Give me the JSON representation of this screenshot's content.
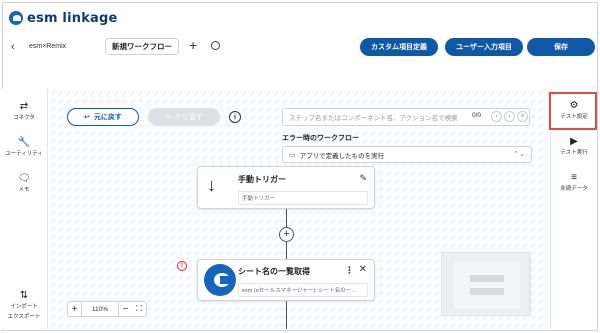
{
  "app": {
    "logo_text": "esm linkage"
  },
  "subbar": {
    "back_icon": "chevron-left-icon",
    "breadcrumb": "esm×Remix",
    "flow_title": "新規ワークフロー",
    "add_symbol": "+",
    "custom_fields_button": "カスタム項目定義",
    "user_input_button": "ユーザー入力項目",
    "save_button": "保存"
  },
  "left_panel": {
    "items": [
      {
        "label": "コネクタ",
        "icon": "swap-arrows-icon",
        "glyph": "⇄"
      },
      {
        "label": "ユーティリティ",
        "icon": "wrench-icon",
        "glyph": "🔧"
      },
      {
        "label": "メモ",
        "icon": "memo-icon",
        "glyph": "🗨"
      },
      {
        "label": "インポート",
        "label2": "エクスポート",
        "icon": "import-export-icon",
        "glyph": "⇅"
      }
    ]
  },
  "right_panel": {
    "items": [
      {
        "label": "テスト設定",
        "icon": "gear-icon",
        "glyph": "⚙"
      },
      {
        "label": "テスト実行",
        "icon": "play-circle-icon",
        "glyph": "▶"
      },
      {
        "label": "永続データ",
        "icon": "database-icon",
        "glyph": "≡"
      }
    ]
  },
  "toolbar": {
    "undo_label": "元に戻す",
    "redo_label": "やり直す",
    "info_glyph": "i",
    "search_placeholder": "ステップ名またはコンポーネント名、アクション名で検索",
    "search_count": "0/0"
  },
  "error_workflow": {
    "label": "エラー時のワークフロー",
    "selected": "アプリで定義したものを実行"
  },
  "nodes": {
    "trigger": {
      "title": "手動トリガー",
      "subtitle": "手動トリガー"
    },
    "step": {
      "title": "シート名の一覧取得",
      "subtitle": "esm (eセールスマネージャー): シート名の一..."
    },
    "add_symbol": "+",
    "warning_glyph": "!"
  },
  "zoom": {
    "minus": "−",
    "plus": "+",
    "level": "110%"
  },
  "colors": {
    "primary": "#0f57a7",
    "highlight": "#e34b4b",
    "warning": "#d32f2f"
  }
}
